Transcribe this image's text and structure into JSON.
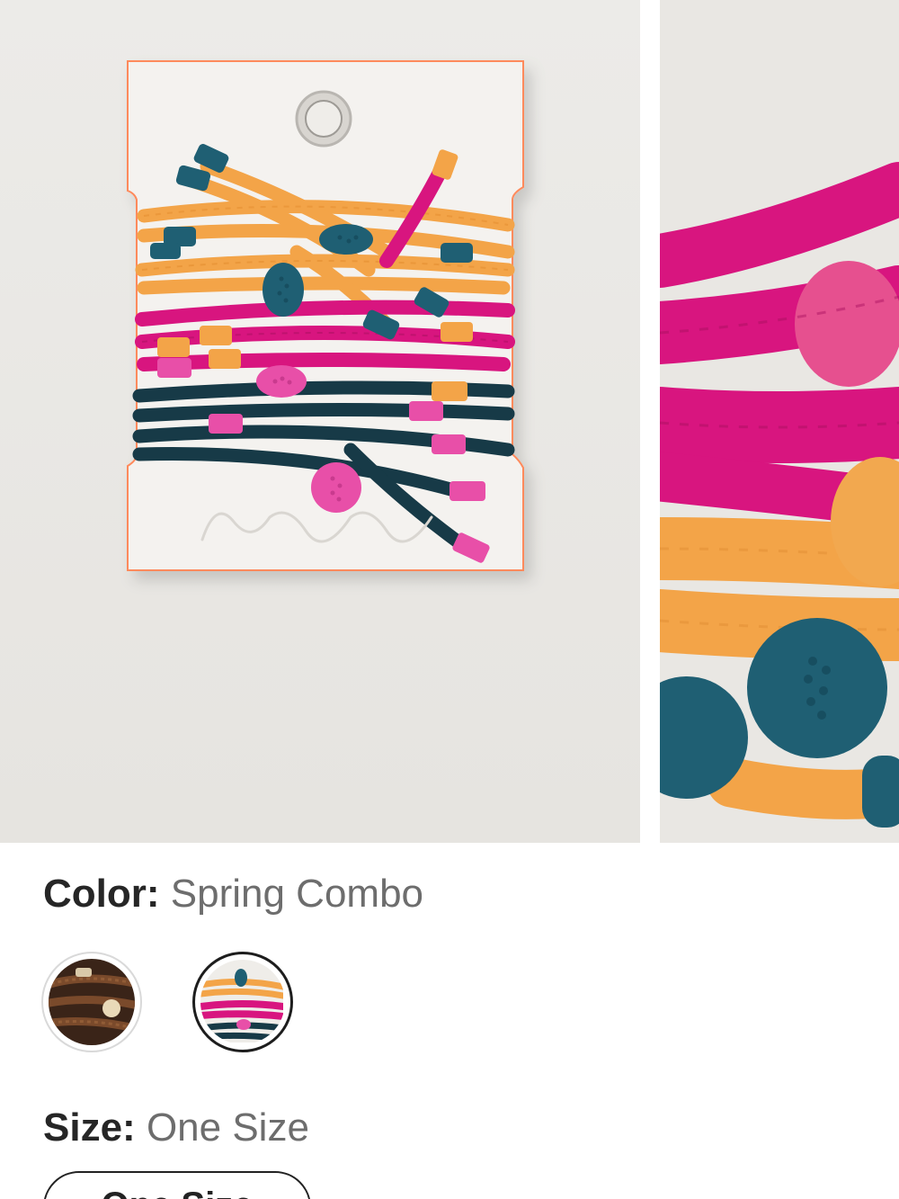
{
  "gallery": {
    "images": [
      {
        "icon": "hair-ties-card-image",
        "alt": ""
      },
      {
        "icon": "hair-ties-closeup-image",
        "alt": ""
      }
    ],
    "card_script": "free people"
  },
  "color": {
    "label": "Color:",
    "value": "Spring Combo",
    "swatches": [
      {
        "icon": "brown-hair-ties-swatch",
        "selected": false
      },
      {
        "icon": "spring-combo-swatch",
        "selected": true
      }
    ]
  },
  "size": {
    "label": "Size:",
    "value": "One Size",
    "option_label": "One Size"
  },
  "colors": {
    "orange": "#f3a448",
    "pink": "#d8157f",
    "navy": "#173a47",
    "teal": "#1f5f73",
    "card_border": "#ff8a5c"
  }
}
